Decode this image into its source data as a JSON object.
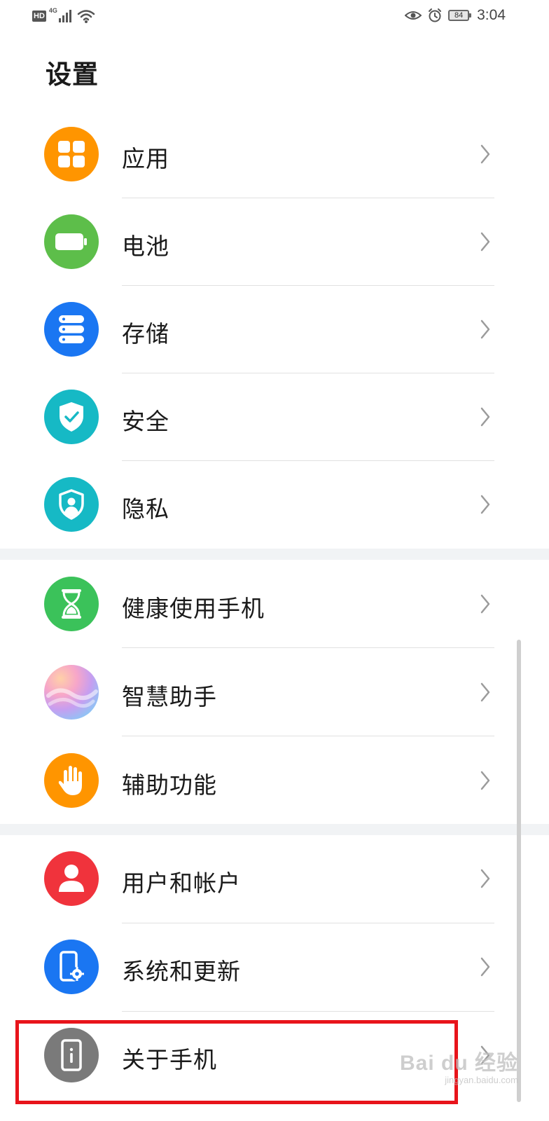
{
  "status_bar": {
    "hd_label": "HD",
    "network_label": "4G",
    "battery_level": "84",
    "time": "3:04"
  },
  "page_title": "设置",
  "groups": [
    {
      "items": [
        {
          "label": "应用",
          "icon": "apps-icon",
          "color": "#FF9500"
        },
        {
          "label": "电池",
          "icon": "battery-icon",
          "color": "#5DBE4A"
        },
        {
          "label": "存储",
          "icon": "storage-icon",
          "color": "#1A76F2"
        },
        {
          "label": "安全",
          "icon": "shield-check-icon",
          "color": "#16B9C5"
        },
        {
          "label": "隐私",
          "icon": "privacy-icon",
          "color": "#16B9C5"
        }
      ]
    },
    {
      "items": [
        {
          "label": "健康使用手机",
          "icon": "hourglass-icon",
          "color": "#3BC25A"
        },
        {
          "label": "智慧助手",
          "icon": "assistant-icon",
          "color": "#C99DE0"
        },
        {
          "label": "辅助功能",
          "icon": "hand-icon",
          "color": "#FF9500"
        }
      ]
    },
    {
      "items": [
        {
          "label": "用户和帐户",
          "icon": "user-icon",
          "color": "#F0333C"
        },
        {
          "label": "系统和更新",
          "icon": "phone-settings-icon",
          "color": "#1A76F2"
        },
        {
          "label": "关于手机",
          "icon": "phone-info-icon",
          "color": "#7A7A7A"
        }
      ]
    }
  ],
  "highlight_color": "#E8141B",
  "watermark": {
    "main": "Bai du 经验",
    "url": "jingyan.baidu.com"
  }
}
